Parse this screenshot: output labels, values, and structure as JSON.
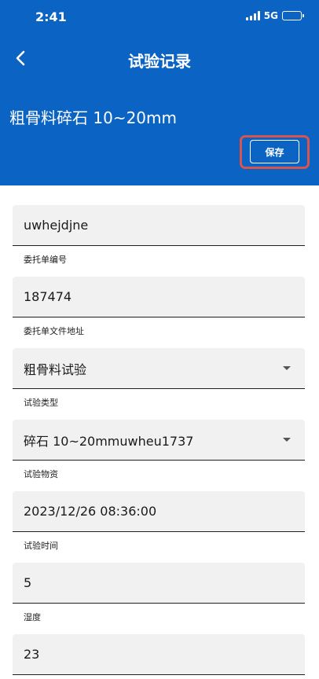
{
  "status": {
    "time": "2:41",
    "network": "5G"
  },
  "nav": {
    "title": "试验记录"
  },
  "material_title": "粗骨料碎石 10~20mm",
  "save_label": "保存",
  "fields": [
    {
      "value": "uwhejdjne",
      "label": "委托单编号",
      "type": "text"
    },
    {
      "value": "187474",
      "label": "委托单文件地址",
      "type": "text"
    },
    {
      "value": "粗骨料试验",
      "label": "试验类型",
      "type": "select"
    },
    {
      "value": "碎石 10~20mmuwheu1737",
      "label": "试验物资",
      "type": "select"
    },
    {
      "value": "2023/12/26 08:36:00",
      "label": "试验时间",
      "type": "text"
    },
    {
      "value": "5",
      "label": "湿度",
      "type": "text"
    },
    {
      "value": "23",
      "label": "",
      "type": "text"
    }
  ],
  "colors": {
    "header": "#0b63c4",
    "highlight": "#d9534f",
    "field_bg": "#f1f1f1"
  },
  "icons": [
    "back-arrow-icon",
    "signal-icon",
    "battery-icon",
    "dropdown-caret-icon"
  ]
}
